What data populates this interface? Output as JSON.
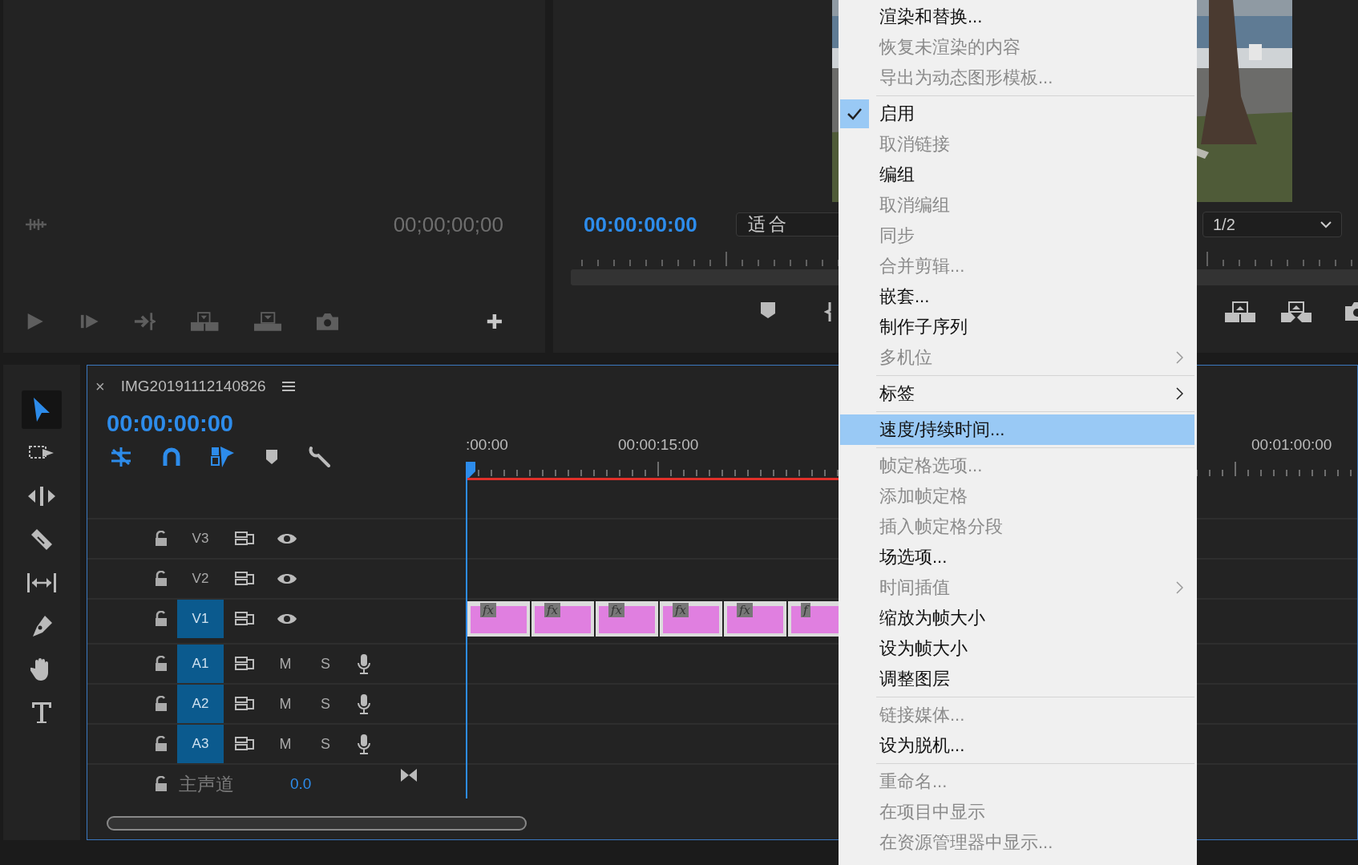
{
  "source_monitor": {
    "timecode": "00;00;00;00"
  },
  "program_monitor": {
    "timecode": "00:00:00:00",
    "zoom": "适合",
    "resolution": "1/2"
  },
  "tools": [
    {
      "kind": "selection",
      "selected": true
    },
    {
      "kind": "track-select",
      "selected": false
    },
    {
      "kind": "ripple",
      "selected": false
    },
    {
      "kind": "razor",
      "selected": false
    },
    {
      "kind": "slip",
      "selected": false
    },
    {
      "kind": "pen",
      "selected": false
    },
    {
      "kind": "hand",
      "selected": false
    },
    {
      "kind": "type",
      "selected": false
    }
  ],
  "timeline": {
    "close": "×",
    "title": "IMG20191112140826",
    "timecode": "00:00:00:00",
    "toggles": [
      {
        "kind": "nest",
        "on": true
      },
      {
        "kind": "snap",
        "on": true
      },
      {
        "kind": "linked",
        "on": true
      },
      {
        "kind": "marker",
        "on": false
      },
      {
        "kind": "settings",
        "on": false
      }
    ],
    "ruler_labels": [
      ":00:00",
      "00:00:15:00",
      "00:01:00:00"
    ],
    "tracks": [
      {
        "name": "V3",
        "kind": "video",
        "targeted": false
      },
      {
        "name": "V2",
        "kind": "video",
        "targeted": false
      },
      {
        "name": "V1",
        "kind": "video",
        "targeted": true
      },
      {
        "name": "A1",
        "kind": "audio",
        "targeted": true,
        "mute": "M",
        "solo": "S"
      },
      {
        "name": "A2",
        "kind": "audio",
        "targeted": true,
        "mute": "M",
        "solo": "S"
      },
      {
        "name": "A3",
        "kind": "audio",
        "targeted": true,
        "mute": "M",
        "solo": "S"
      }
    ],
    "master": {
      "name": "主声道",
      "reading": "0.0"
    },
    "clips": [
      {
        "label": "fx"
      },
      {
        "label": "fx"
      },
      {
        "label": "fx"
      },
      {
        "label": "fx"
      },
      {
        "label": "fx"
      },
      {
        "label": "f"
      }
    ]
  },
  "context_menu": {
    "items": [
      {
        "kind": "item",
        "label": "渲染和替换...",
        "enabled": true,
        "checked": false,
        "selected": false,
        "submenu": false
      },
      {
        "kind": "item",
        "label": "恢复未渲染的内容",
        "enabled": false,
        "checked": false,
        "selected": false,
        "submenu": false
      },
      {
        "kind": "item",
        "label": "导出为动态图形模板...",
        "enabled": false,
        "checked": false,
        "selected": false,
        "submenu": false
      },
      {
        "kind": "separator"
      },
      {
        "kind": "item",
        "label": "启用",
        "enabled": true,
        "checked": true,
        "selected": false,
        "submenu": false
      },
      {
        "kind": "item",
        "label": "取消链接",
        "enabled": false,
        "checked": false,
        "selected": false,
        "submenu": false
      },
      {
        "kind": "item",
        "label": "编组",
        "enabled": true,
        "checked": false,
        "selected": false,
        "submenu": false
      },
      {
        "kind": "item",
        "label": "取消编组",
        "enabled": false,
        "checked": false,
        "selected": false,
        "submenu": false
      },
      {
        "kind": "item",
        "label": "同步",
        "enabled": false,
        "checked": false,
        "selected": false,
        "submenu": false
      },
      {
        "kind": "item",
        "label": "合并剪辑...",
        "enabled": false,
        "checked": false,
        "selected": false,
        "submenu": false
      },
      {
        "kind": "item",
        "label": "嵌套...",
        "enabled": true,
        "checked": false,
        "selected": false,
        "submenu": false
      },
      {
        "kind": "item",
        "label": "制作子序列",
        "enabled": true,
        "checked": false,
        "selected": false,
        "submenu": false
      },
      {
        "kind": "item",
        "label": "多机位",
        "enabled": false,
        "checked": false,
        "selected": false,
        "submenu": true
      },
      {
        "kind": "separator"
      },
      {
        "kind": "item",
        "label": "标签",
        "enabled": true,
        "checked": false,
        "selected": false,
        "submenu": true
      },
      {
        "kind": "separator"
      },
      {
        "kind": "item",
        "label": "速度/持续时间...",
        "enabled": true,
        "checked": false,
        "selected": true,
        "submenu": false
      },
      {
        "kind": "separator"
      },
      {
        "kind": "item",
        "label": "帧定格选项...",
        "enabled": false,
        "checked": false,
        "selected": false,
        "submenu": false
      },
      {
        "kind": "item",
        "label": "添加帧定格",
        "enabled": false,
        "checked": false,
        "selected": false,
        "submenu": false
      },
      {
        "kind": "item",
        "label": "插入帧定格分段",
        "enabled": false,
        "checked": false,
        "selected": false,
        "submenu": false
      },
      {
        "kind": "item",
        "label": "场选项...",
        "enabled": true,
        "checked": false,
        "selected": false,
        "submenu": false
      },
      {
        "kind": "item",
        "label": "时间插值",
        "enabled": false,
        "checked": false,
        "selected": false,
        "submenu": true
      },
      {
        "kind": "item",
        "label": "缩放为帧大小",
        "enabled": true,
        "checked": false,
        "selected": false,
        "submenu": false
      },
      {
        "kind": "item",
        "label": "设为帧大小",
        "enabled": true,
        "checked": false,
        "selected": false,
        "submenu": false
      },
      {
        "kind": "item",
        "label": "调整图层",
        "enabled": true,
        "checked": false,
        "selected": false,
        "submenu": false
      },
      {
        "kind": "separator"
      },
      {
        "kind": "item",
        "label": "链接媒体...",
        "enabled": false,
        "checked": false,
        "selected": false,
        "submenu": false
      },
      {
        "kind": "item",
        "label": "设为脱机...",
        "enabled": true,
        "checked": false,
        "selected": false,
        "submenu": false
      },
      {
        "kind": "separator"
      },
      {
        "kind": "item",
        "label": "重命名...",
        "enabled": false,
        "checked": false,
        "selected": false,
        "submenu": false
      },
      {
        "kind": "item",
        "label": "在项目中显示",
        "enabled": false,
        "checked": false,
        "selected": false,
        "submenu": false
      },
      {
        "kind": "item",
        "label": "在资源管理器中显示...",
        "enabled": false,
        "checked": false,
        "selected": false,
        "submenu": false
      }
    ]
  }
}
